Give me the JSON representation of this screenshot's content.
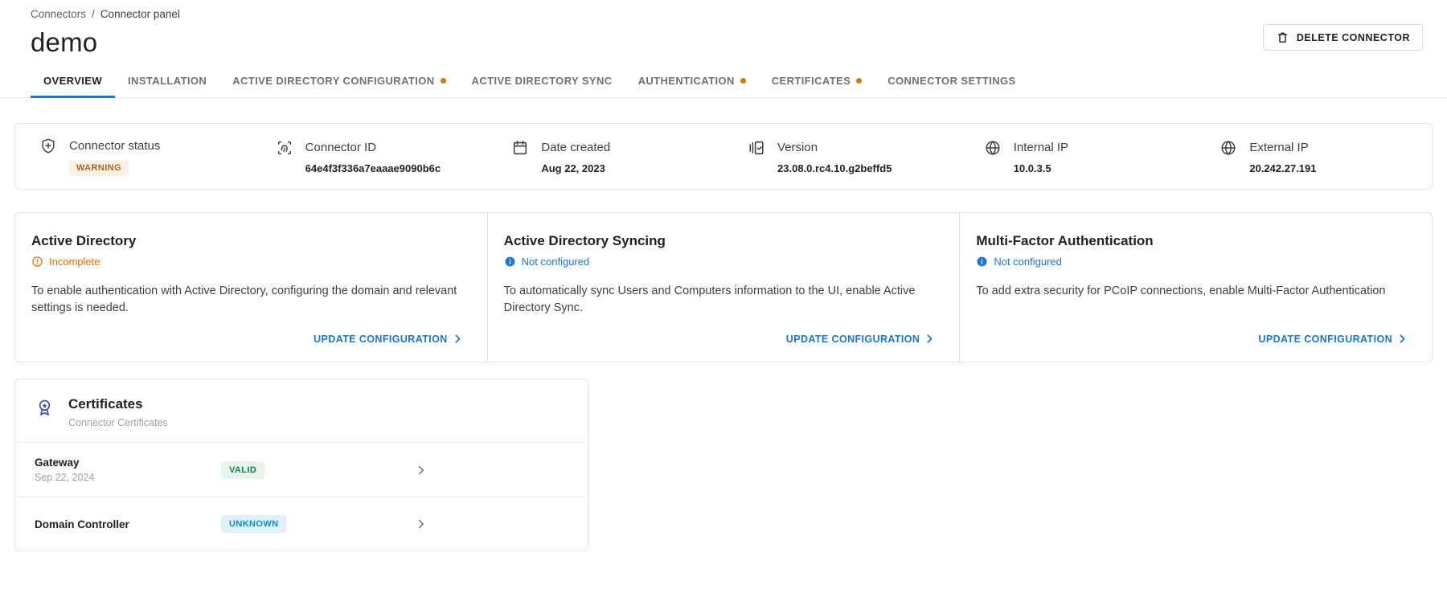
{
  "breadcrumb": {
    "parent": "Connectors",
    "separator": "/",
    "current": "Connector panel"
  },
  "header": {
    "title": "demo",
    "delete_button": "DELETE CONNECTOR"
  },
  "tabs": [
    {
      "label": "OVERVIEW",
      "active": true,
      "dot": false
    },
    {
      "label": "INSTALLATION",
      "active": false,
      "dot": false
    },
    {
      "label": "ACTIVE DIRECTORY CONFIGURATION",
      "active": false,
      "dot": true
    },
    {
      "label": "ACTIVE DIRECTORY SYNC",
      "active": false,
      "dot": false
    },
    {
      "label": "AUTHENTICATION",
      "active": false,
      "dot": true
    },
    {
      "label": "CERTIFICATES",
      "active": false,
      "dot": true
    },
    {
      "label": "CONNECTOR SETTINGS",
      "active": false,
      "dot": false
    }
  ],
  "info_bar": [
    {
      "icon": "shield-plus-icon",
      "label": "Connector status",
      "badge": "WARNING"
    },
    {
      "icon": "fingerprint-scan-icon",
      "label": "Connector ID",
      "value": "64e4f3f336a7eaaae9090b6c"
    },
    {
      "icon": "calendar-icon",
      "label": "Date created",
      "value": "Aug 22, 2023"
    },
    {
      "icon": "version-icon",
      "label": "Version",
      "value": "23.08.0.rc4.10.g2beffd5"
    },
    {
      "icon": "globe-icon",
      "label": "Internal IP",
      "value": "10.0.3.5"
    },
    {
      "icon": "globe-icon",
      "label": "External IP",
      "value": "20.242.27.191"
    }
  ],
  "status_cards": [
    {
      "title": "Active Directory",
      "status": "Incomplete",
      "status_type": "warning",
      "description": "To enable authentication with Active Directory, configuring the domain and relevant settings is needed.",
      "action": "UPDATE CONFIGURATION"
    },
    {
      "title": "Active Directory Syncing",
      "status": "Not configured",
      "status_type": "info",
      "description": "To automatically sync Users and Computers information to the UI, enable Active Directory Sync.",
      "action": "UPDATE CONFIGURATION"
    },
    {
      "title": "Multi-Factor Authentication",
      "status": "Not configured",
      "status_type": "info",
      "description": "To add extra security for PCoIP connections, enable Multi-Factor Authentication",
      "action": "UPDATE CONFIGURATION"
    }
  ],
  "certificates": {
    "title": "Certificates",
    "subtitle": "Connector Certificates",
    "rows": [
      {
        "name": "Gateway",
        "date": "Sep 22, 2024",
        "badge": "VALID",
        "badge_type": "valid"
      },
      {
        "name": "Domain Controller",
        "badge": "UNKNOWN",
        "badge_type": "unknown"
      }
    ]
  },
  "colors": {
    "accent_blue": "#1976d2",
    "tab_notification_dot": "#d47b00",
    "warning_orange": "#ed6c02",
    "warning_badge_text": "#a4642a",
    "warning_badge_bg": "#fdf1e4",
    "valid_badge_text": "#1b8149",
    "valid_badge_bg": "#e6f6ec",
    "unknown_badge_text": "#0a8ecb",
    "unknown_badge_bg": "#def2fb",
    "certificate_icon": "#3f4b9e"
  }
}
